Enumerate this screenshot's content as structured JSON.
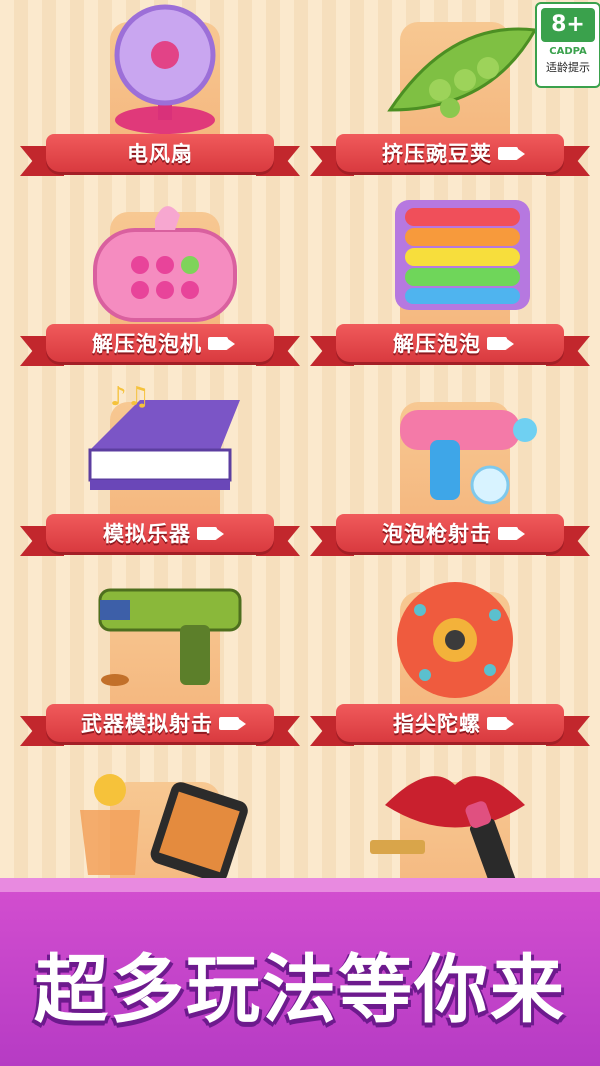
{
  "rating": {
    "age": "8+",
    "org": "CADPA",
    "hint": "适龄提示"
  },
  "games": [
    {
      "label": "电风扇",
      "icon": "fan-icon",
      "video": false
    },
    {
      "label": "挤压豌豆荚",
      "icon": "pea-pod-icon",
      "video": true
    },
    {
      "label": "解压泡泡机",
      "icon": "pop-it-console-icon",
      "video": true
    },
    {
      "label": "解压泡泡",
      "icon": "pop-it-board-icon",
      "video": true
    },
    {
      "label": "模拟乐器",
      "icon": "piano-icon",
      "video": true
    },
    {
      "label": "泡泡枪射击",
      "icon": "bubble-gun-icon",
      "video": true
    },
    {
      "label": "武器模拟射击",
      "icon": "toy-pistol-icon",
      "video": true
    },
    {
      "label": "指尖陀螺",
      "icon": "fidget-spinner-icon",
      "video": true
    },
    {
      "label": "",
      "icon": "drink-and-phone-icon",
      "video": false
    },
    {
      "label": "",
      "icon": "lips-lipstick-icon",
      "video": false
    }
  ],
  "slogan": "超多玩法等你来",
  "colors": {
    "ribbon": "#d93a3f",
    "footer": "#c145c9",
    "pad": "#f4b37a"
  }
}
